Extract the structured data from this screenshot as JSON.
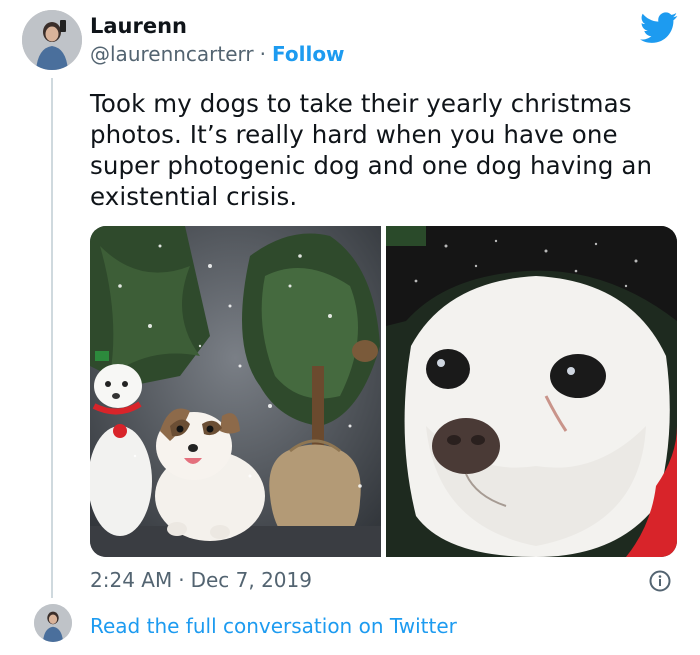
{
  "author": {
    "name": "Laurenn",
    "handle": "@laurenncarterr",
    "separator": "·",
    "follow_label": "Follow"
  },
  "tweet": {
    "text": "Took my dogs to take their yearly christmas photos. It’s really hard when you have one super photogenic dog and one dog having an existential crisis.",
    "time": "2:24 AM",
    "separator": "·",
    "date": "Dec 7, 2019"
  },
  "footer": {
    "read_more_label": "Read the full conversation on Twitter"
  },
  "icons": {
    "brand": "twitter-bird-icon",
    "info": "info-icon"
  },
  "colors": {
    "accent": "#1d9bf0",
    "text": "#0f1419",
    "muted": "#536471"
  }
}
